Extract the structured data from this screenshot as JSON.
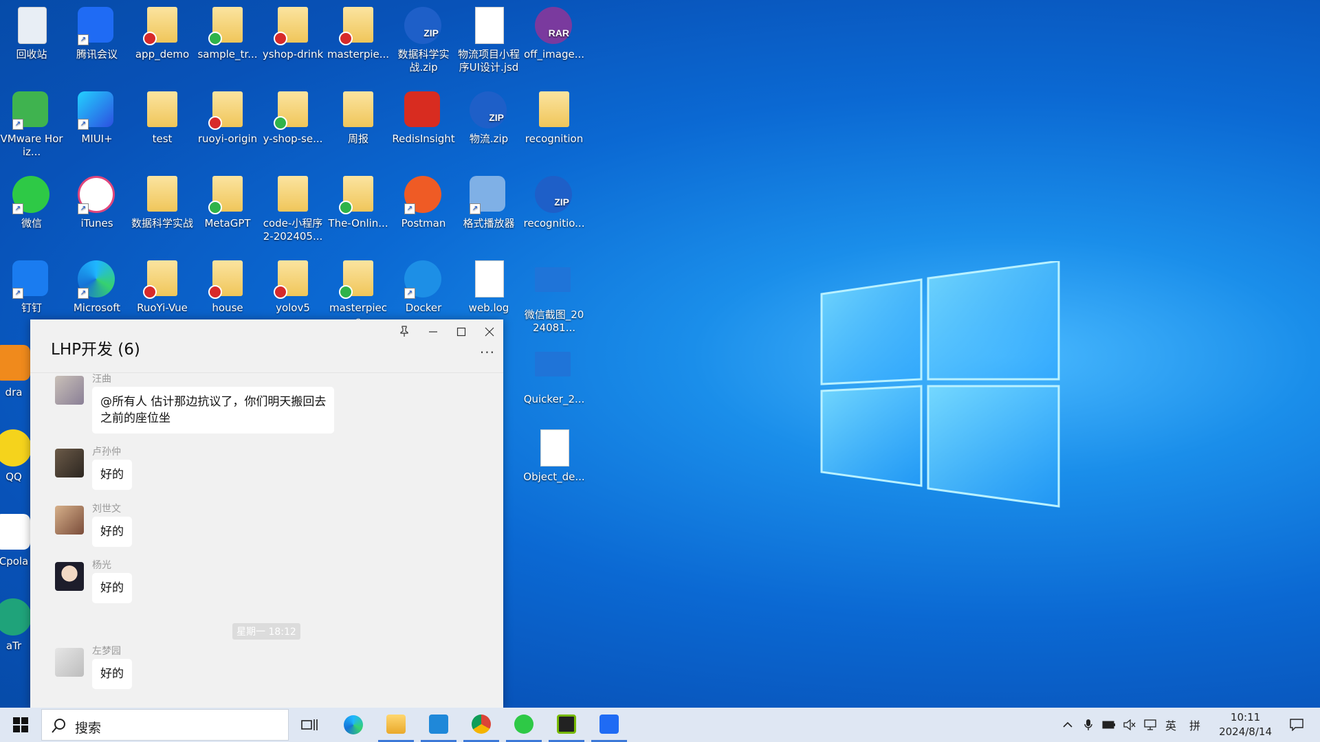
{
  "desktop": {
    "icons": [
      {
        "label": "回收站"
      },
      {
        "label": "腾讯会议"
      },
      {
        "label": "app_demo"
      },
      {
        "label": "sample_tr..."
      },
      {
        "label": "yshop-drink"
      },
      {
        "label": "masterpie..."
      },
      {
        "label": "数据科学实战.zip"
      },
      {
        "label": "物流项目小程序UI设计.jsd"
      },
      {
        "label": "off_image..."
      },
      {
        "label": "VMware Horiz..."
      },
      {
        "label": "MIUI+"
      },
      {
        "label": "test"
      },
      {
        "label": "ruoyi-origin"
      },
      {
        "label": "y-shop-se..."
      },
      {
        "label": "周报"
      },
      {
        "label": "RedisInsight"
      },
      {
        "label": "物流.zip"
      },
      {
        "label": "recognition"
      },
      {
        "label": "微信"
      },
      {
        "label": "iTunes"
      },
      {
        "label": "数据科学实战"
      },
      {
        "label": "MetaGPT"
      },
      {
        "label": "code-小程序2-202405..."
      },
      {
        "label": "The-Onlin..."
      },
      {
        "label": "Postman"
      },
      {
        "label": "格式播放器"
      },
      {
        "label": "recognitio..."
      },
      {
        "label": "钉钉"
      },
      {
        "label": "Microsoft"
      },
      {
        "label": "RuoYi-Vue"
      },
      {
        "label": "house"
      },
      {
        "label": "yolov5"
      },
      {
        "label": "masterpiece"
      },
      {
        "label": "Docker"
      },
      {
        "label": "web.log"
      },
      {
        "label": "微信截图_2024081..."
      },
      {
        "label": "dra"
      },
      {
        "label": "Quicker_2..."
      },
      {
        "label": "QQ"
      },
      {
        "label": "Object_de..."
      },
      {
        "label": "Cpola"
      },
      {
        "label": "aTr"
      }
    ],
    "ext_labels": {
      "zip": "ZIP",
      "rar": "RAR"
    }
  },
  "chat": {
    "title": "LHP开发 (6)",
    "more_label": "···",
    "timestamp": "星期一 18:12",
    "messages": [
      {
        "sender": "汪曲",
        "text_line1": "@所有人 估计那边抗议了，你们明天搬回去",
        "text_line2": "之前的座位坐"
      },
      {
        "sender": "卢孙仲",
        "text": "好的"
      },
      {
        "sender": "刘世文",
        "text": "好的"
      },
      {
        "sender": "杨光",
        "text": "好的"
      },
      {
        "sender": "左梦园",
        "text": "好的"
      }
    ]
  },
  "taskbar": {
    "search_placeholder": "搜索",
    "tray": {
      "ime_lang": "英",
      "ime_mode": "拼"
    },
    "time": "10:11",
    "date": "2024/8/14"
  },
  "colors": {
    "accent": "#3b78d8",
    "taskbar": "#dfe7f3",
    "chat_bg": "#f1f1f1"
  }
}
